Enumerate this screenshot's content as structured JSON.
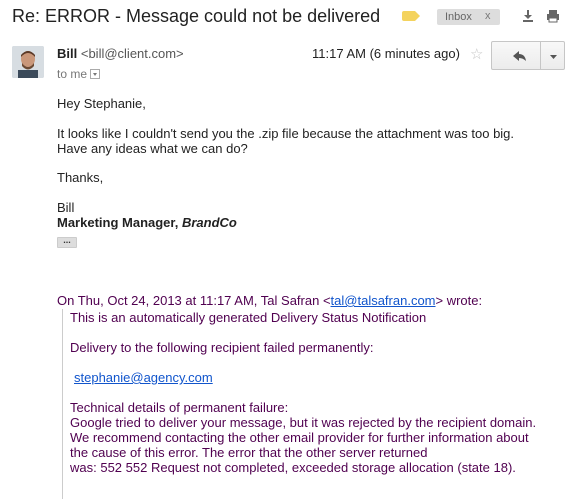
{
  "subject": "Re: ERROR - Message could not be delivered",
  "label": {
    "name": "Inbox",
    "remove": "x"
  },
  "colors": {
    "label_tag": "#f4d35e",
    "quoted_text": "#500050",
    "link": "#1155cc"
  },
  "icons": {
    "download": "download-icon",
    "print": "print-icon",
    "star": "star-icon",
    "reply": "reply-arrow-icon",
    "more": "chevron-down-icon"
  },
  "message": {
    "sender_name": "Bill",
    "sender_email": "<bill@client.com>",
    "time": "11:17 AM (6 minutes ago)",
    "recipient": "to me",
    "greeting": "Hey Stephanie,",
    "body_line1": "It looks like I couldn't send you the .zip file because the attachment was too big.",
    "body_line2": "Have any ideas what we can do?",
    "closing": "Thanks,",
    "signature_name": "Bill",
    "signature_title": "Marketing Manager, ",
    "signature_company": "BrandCo",
    "trimmed": "..."
  },
  "quoted": {
    "header_prefix": "On Thu, Oct 24, 2013 at 11:17 AM, Tal Safran <",
    "header_email": "tal@talsafran.com",
    "header_suffix": "> wrote:",
    "line1": "This is an automatically generated Delivery Status Notification",
    "line2": "Delivery to the following recipient failed permanently:",
    "recipient_email": "stephanie@agency.com",
    "details_title": "Technical details of permanent failure:",
    "details1": "Google tried to deliver your message, but it was rejected by the recipient domain.",
    "details2": "We recommend contacting the other email provider for further information about",
    "details3": "the cause of this error. The error that the other server returned",
    "details4": "was: 552 552 Request not completed, exceeded storage allocation  (state 18)."
  }
}
